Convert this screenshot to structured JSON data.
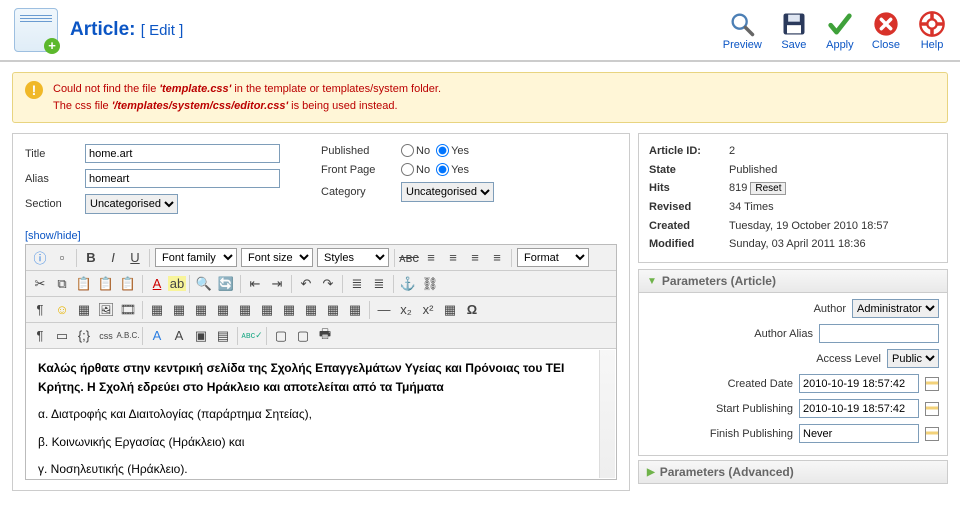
{
  "header": {
    "title": "Article:",
    "subtitle": "[ Edit ]"
  },
  "toolbar": {
    "preview": "Preview",
    "save": "Save",
    "apply": "Apply",
    "close": "Close",
    "help": "Help"
  },
  "alert": {
    "line1a": "Could not find the file ",
    "line1b": "'template.css'",
    "line1c": " in the template or templates/system folder.",
    "line2a": "The css file ",
    "line2b": "'/templates/system/css/editor.css'",
    "line2c": " is being used instead."
  },
  "form": {
    "title_label": "Title",
    "title_value": "home.art",
    "alias_label": "Alias",
    "alias_value": "homeart",
    "section_label": "Section",
    "section_value": "Uncategorised",
    "published_label": "Published",
    "frontpage_label": "Front Page",
    "category_label": "Category",
    "category_value": "Uncategorised",
    "no": "No",
    "yes": "Yes"
  },
  "showhide": "[show/hide]",
  "editor": {
    "font_family": "Font family",
    "font_size": "Font size",
    "styles": "Styles",
    "format": "Format"
  },
  "content": {
    "p1": "Καλώς ήρθατε στην κεντρική σελίδα της Σχολής Επαγγελμάτων Υγείας και Πρόνοιας του ΤΕΙ Κρήτης. Η Σχολή εδρεύει στο Ηράκλειο και αποτελείται από τα Τμήματα",
    "p2": "α. Διατροφής και Διαιτολογίας (παράρτημα Σητείας),",
    "p3": "β. Κοινωνικής Εργασίας (Ηράκλειο) και",
    "p4": "γ. Νοσηλευτικής (Ηράκλειο)."
  },
  "info": {
    "article_id_k": "Article ID:",
    "article_id_v": "2",
    "state_k": "State",
    "state_v": "Published",
    "hits_k": "Hits",
    "hits_v": "819",
    "reset": "Reset",
    "revised_k": "Revised",
    "revised_v": "34 Times",
    "created_k": "Created",
    "created_v": "Tuesday, 19 October 2010 18:57",
    "modified_k": "Modified",
    "modified_v": "Sunday, 03 April 2011 18:36"
  },
  "params": {
    "article_head": "Parameters (Article)",
    "advanced_head": "Parameters (Advanced)",
    "author_label": "Author",
    "author_value": "Administrator",
    "author_alias_label": "Author Alias",
    "author_alias_value": "",
    "access_label": "Access Level",
    "access_value": "Public",
    "created_label": "Created Date",
    "created_value": "2010-10-19 18:57:42",
    "start_label": "Start Publishing",
    "start_value": "2010-10-19 18:57:42",
    "finish_label": "Finish Publishing",
    "finish_value": "Never"
  }
}
